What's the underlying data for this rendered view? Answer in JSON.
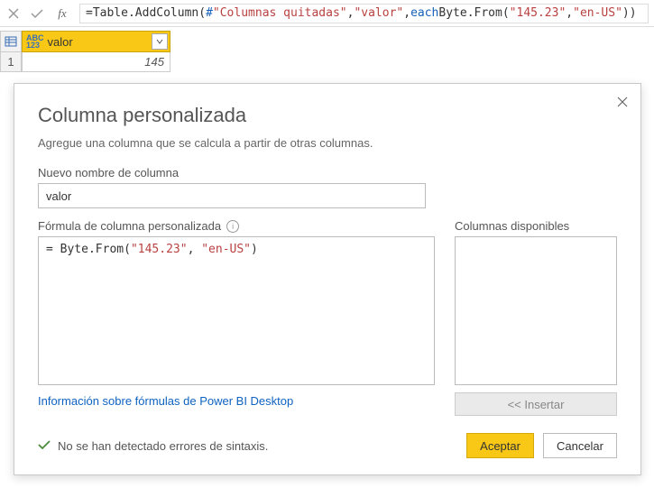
{
  "formula_bar": {
    "fx_label": "fx",
    "formula_prefix": "= ",
    "tokens": {
      "table": "Table",
      "dot": ".",
      "addcol": "AddColumn",
      "lp": "(",
      "hash": "#",
      "arg1": "\"Columnas quitadas\"",
      "comma": ", ",
      "arg2": "\"valor\"",
      "each": "each ",
      "byte": "Byte",
      "from": "From",
      "arg3": "\"145.23\"",
      "arg4": "\"en-US\"",
      "rp": ")",
      "rp2": ")"
    }
  },
  "table": {
    "col_type_label": "ABC\n123",
    "col_name": "valor",
    "rows": [
      {
        "num": "1",
        "value": "145"
      }
    ]
  },
  "dialog": {
    "title": "Columna personalizada",
    "subtitle": "Agregue una columna que se calcula a partir de otras columnas.",
    "newcol_label": "Nuevo nombre de columna",
    "newcol_value": "valor",
    "formula_label": "Fórmula de columna personalizada",
    "formula_tokens": {
      "eq": "= ",
      "byte": "Byte",
      "dot": ".",
      "from": "From",
      "lp": "(",
      "s1": "\"145.23\"",
      "comma": ", ",
      "s2": "\"en-US\"",
      "rp": ")"
    },
    "avail_label": "Columnas disponibles",
    "insert_label": "<< Insertar",
    "link_text": "Información sobre fórmulas de Power BI Desktop",
    "status_text": "No se han detectado errores de sintaxis.",
    "accept_label": "Aceptar",
    "cancel_label": "Cancelar"
  }
}
